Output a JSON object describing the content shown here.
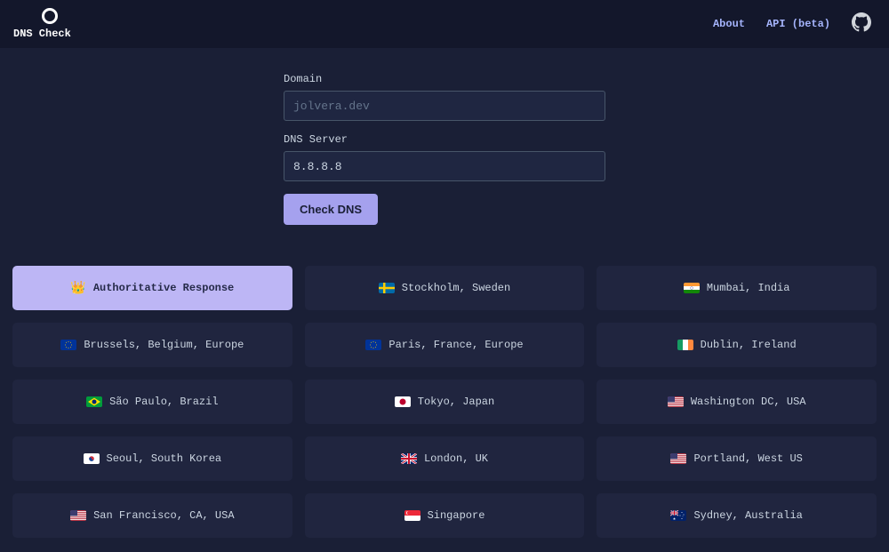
{
  "header": {
    "logo_text": "DNS Check",
    "nav": {
      "about": "About",
      "api": "API (beta)"
    }
  },
  "form": {
    "domain_label": "Domain",
    "domain_placeholder": "jolvera.dev",
    "server_label": "DNS Server",
    "server_value": "8.8.8.8",
    "button_label": "Check DNS"
  },
  "cards": [
    {
      "flag": "crown",
      "label": "Authoritative Response",
      "active": true
    },
    {
      "flag": "se",
      "label": "Stockholm, Sweden"
    },
    {
      "flag": "in",
      "label": "Mumbai, India"
    },
    {
      "flag": "eu",
      "label": "Brussels, Belgium, Europe"
    },
    {
      "flag": "eu",
      "label": "Paris, France, Europe"
    },
    {
      "flag": "ie",
      "label": "Dublin, Ireland"
    },
    {
      "flag": "br",
      "label": "São Paulo, Brazil"
    },
    {
      "flag": "jp",
      "label": "Tokyo, Japan"
    },
    {
      "flag": "us",
      "label": "Washington DC, USA"
    },
    {
      "flag": "kr",
      "label": "Seoul, South Korea"
    },
    {
      "flag": "gb",
      "label": "London, UK"
    },
    {
      "flag": "us",
      "label": "Portland, West US"
    },
    {
      "flag": "us",
      "label": "San Francisco, CA, USA"
    },
    {
      "flag": "sg",
      "label": "Singapore"
    },
    {
      "flag": "au",
      "label": "Sydney, Australia"
    }
  ]
}
